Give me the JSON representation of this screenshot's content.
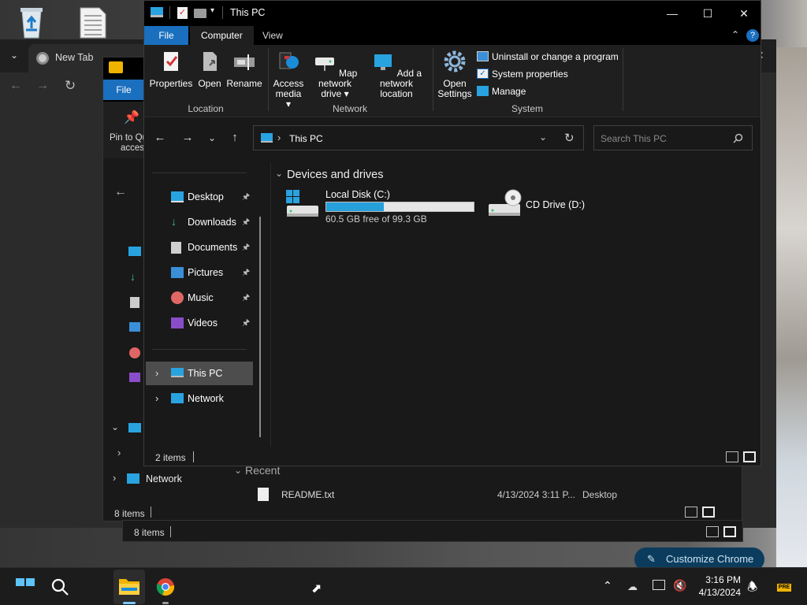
{
  "explorer": {
    "title": "This PC",
    "window_controls": {
      "minimize": "—",
      "maximize": "☐",
      "close": "✕"
    },
    "ribbon_tabs": [
      "File",
      "Computer",
      "View"
    ],
    "ribbon": {
      "location": {
        "label": "Location",
        "buttons": [
          "Properties",
          "Open",
          "Rename"
        ]
      },
      "network": {
        "label": "Network",
        "access_media": [
          "Access",
          "media ▾"
        ],
        "map_drive": [
          "Map network",
          "drive ▾"
        ],
        "add_location": [
          "Add a network",
          "location"
        ]
      },
      "system": {
        "label": "System",
        "open_settings": [
          "Open",
          "Settings"
        ],
        "links": [
          "Uninstall or change a program",
          "System properties",
          "Manage"
        ]
      }
    },
    "address": {
      "path": "This PC"
    },
    "search": {
      "placeholder": "Search This PC"
    },
    "nav": {
      "quick": [
        {
          "label": "Desktop",
          "icon": "desktop-icon"
        },
        {
          "label": "Downloads",
          "icon": "downloads-icon"
        },
        {
          "label": "Documents",
          "icon": "documents-icon"
        },
        {
          "label": "Pictures",
          "icon": "pictures-icon"
        },
        {
          "label": "Music",
          "icon": "music-icon"
        },
        {
          "label": "Videos",
          "icon": "videos-icon"
        }
      ],
      "this_pc": "This PC",
      "network": "Network"
    },
    "content": {
      "group_title": "Devices and drives",
      "drives": [
        {
          "name": "Local Disk (C:)",
          "free_text": "60.5 GB free of 99.3 GB",
          "used_fraction": 0.39
        },
        {
          "name": "CD Drive (D:)"
        }
      ]
    },
    "status": "2 items"
  },
  "background_explorer": {
    "ribbon_tab": "File",
    "pin_label": [
      "Pin to Qu",
      "access"
    ],
    "network_label": "Network",
    "recent_group": "Recent",
    "recent_file": {
      "name": "README.txt",
      "date": "4/13/2024 3:11 P...",
      "location": "Desktop"
    },
    "status": "8 items",
    "status_bottom": "8 items"
  },
  "chrome": {
    "tab_title": "New Tab",
    "customize_button": "Customize Chrome"
  },
  "taskbar": {
    "time": "3:16 PM",
    "date": "4/13/2024"
  },
  "colors": {
    "accent": "#1a8cd8",
    "drive_bar": "#26a0da",
    "selected_nav": "#4d4d4d",
    "chrome_button": "#0b3c5d"
  }
}
